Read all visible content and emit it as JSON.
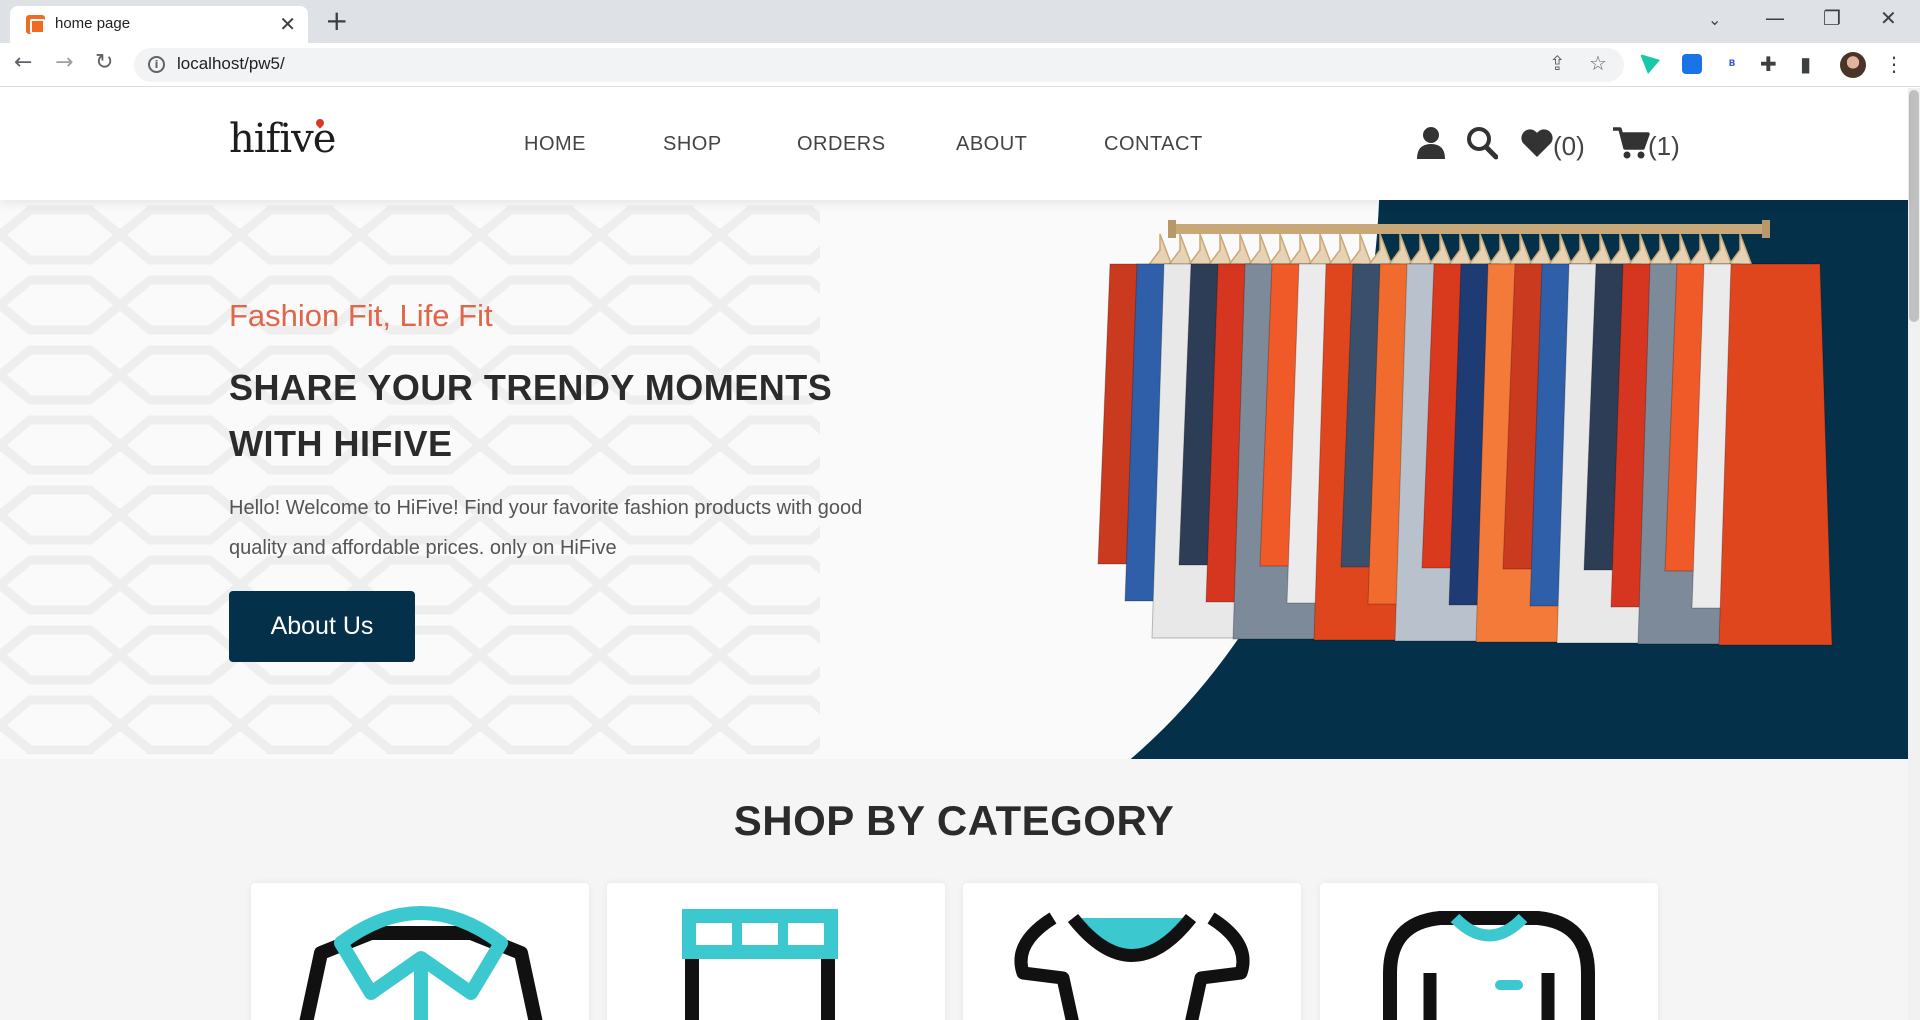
{
  "browser": {
    "tab_title": "home page",
    "url": "localhost/pw5/"
  },
  "header": {
    "logo": "hifive",
    "nav": [
      "HOME",
      "SHOP",
      "ORDERS",
      "ABOUT",
      "CONTACT"
    ],
    "wishlist_count": "(0)",
    "cart_count": "(1)"
  },
  "hero": {
    "tagline": "Fashion Fit, Life Fit",
    "heading": "SHARE YOUR TRENDY MOMENTS WITH HIFIVE",
    "description": "Hello! Welcome to HiFive! Find your favorite fashion products with good quality and affordable prices. only on HiFive",
    "button_label": "About Us"
  },
  "category": {
    "title": "SHOP BY CATEGORY"
  },
  "colors": {
    "navy": "#05304a",
    "accent": "#e0664a",
    "teal": "#3cc8cf"
  }
}
